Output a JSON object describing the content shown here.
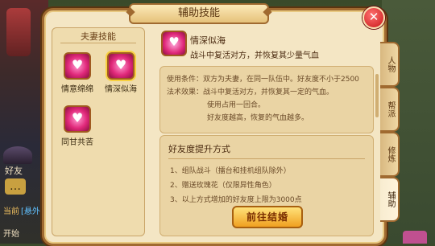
{
  "background": {
    "left_chat_label": "好友",
    "left_current_label": "当前",
    "left_current_channel": "[悬外",
    "left_bottom_label": "开始"
  },
  "panel": {
    "title": "辅助技能",
    "close_icon": "close-x-icon"
  },
  "skills_panel": {
    "title": "夫妻技能",
    "skills": [
      {
        "name": "情意绵绵",
        "icon": "heart-icon",
        "selected": false
      },
      {
        "name": "情深似海",
        "icon": "heart-icon",
        "selected": true
      },
      {
        "name": "同甘共苦",
        "icon": "heart-icon",
        "selected": false
      }
    ]
  },
  "selected_skill": {
    "name": "情深似海",
    "description": "战斗中复活对方，并恢复其少量气血",
    "conditions": [
      "使用条件：双方为夫妻，在同一队伍中。好友度不小于2500",
      "法术效果：战斗中复活对方，并恢复其一定的气血。",
      "使用占用一回合。",
      "好友度越高，恢复的气血越多。"
    ]
  },
  "friendship": {
    "title": "好友度提升方式",
    "items": [
      "1、组队战斗（擂台和挂机组队除外）",
      "2、赠送玫瑰花（仅限异性角色）",
      "3、以上方式增加的好友度上限为3000点"
    ],
    "button_label": "前往结婚"
  },
  "side_tabs": [
    {
      "label": "人物",
      "active": false
    },
    {
      "label": "帮派",
      "active": false
    },
    {
      "label": "修炼",
      "active": false
    },
    {
      "label": "辅助",
      "active": true
    }
  ],
  "colors": {
    "panel_bg": "#f4e6c4",
    "border": "#a06a30",
    "accent_button": "#f0a020",
    "close_red": "#c81818"
  }
}
